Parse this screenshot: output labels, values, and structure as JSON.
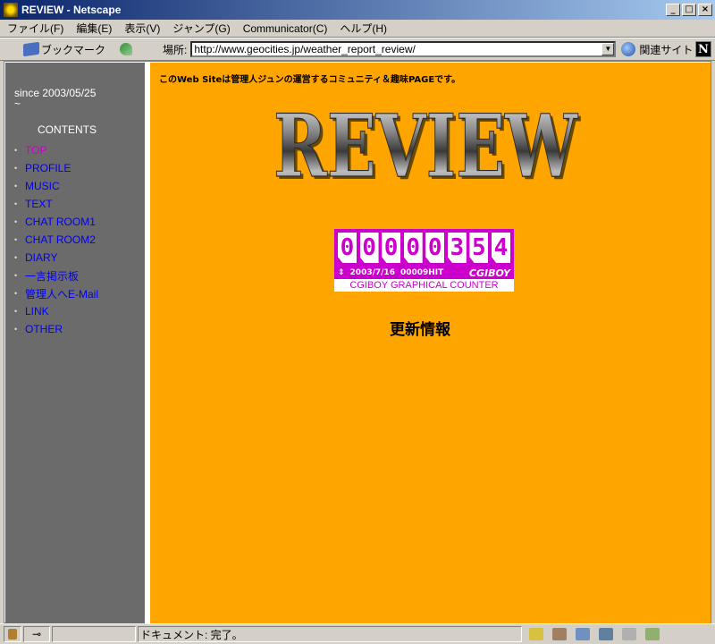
{
  "window": {
    "title": "REVIEW - Netscape"
  },
  "menu": {
    "items": [
      "ファイル(F)",
      "編集(E)",
      "表示(V)",
      "ジャンプ(G)",
      "Communicator(C)",
      "ヘルプ(H)"
    ]
  },
  "toolbar": {
    "bookmarks_label": "ブックマーク",
    "location_label": "場所:",
    "url": "http://www.geocities.jp/weather_report_review/",
    "related_label": "関連サイト"
  },
  "sidebar": {
    "since": "since 2003/05/25",
    "since_tilde": "~",
    "contents_heading": "CONTENTS",
    "items": [
      {
        "label": "TOP",
        "current": true
      },
      {
        "label": "PROFILE"
      },
      {
        "label": "MUSIC"
      },
      {
        "label": "TEXT"
      },
      {
        "label": "CHAT ROOM1"
      },
      {
        "label": "CHAT ROOM2"
      },
      {
        "label": "DIARY"
      },
      {
        "label": "一言掲示板"
      },
      {
        "label": "管理人へE-Mail"
      },
      {
        "label": "LINK"
      },
      {
        "label": "OTHER"
      }
    ]
  },
  "main": {
    "tagline": "このWeb Siteは管理人ジュンの運営するコミュニティ＆趣味PAGEです。",
    "logo_text": "REVIEW",
    "counter": {
      "digits": [
        "0",
        "0",
        "0",
        "0",
        "0",
        "3",
        "5",
        "4"
      ],
      "date": "2003/7/16",
      "hit": "00009HIT",
      "brand": "CGIBOY",
      "footer": "CGIBOY GRAPHICAL COUNTER"
    },
    "update_heading": "更新情報"
  },
  "status": {
    "text": "ドキュメント: 完了。"
  },
  "colors": {
    "page_bg": "#ffa500",
    "sidebar_bg": "#6b6b6b",
    "link": "#0000ee",
    "visited": "#cc00cc"
  }
}
